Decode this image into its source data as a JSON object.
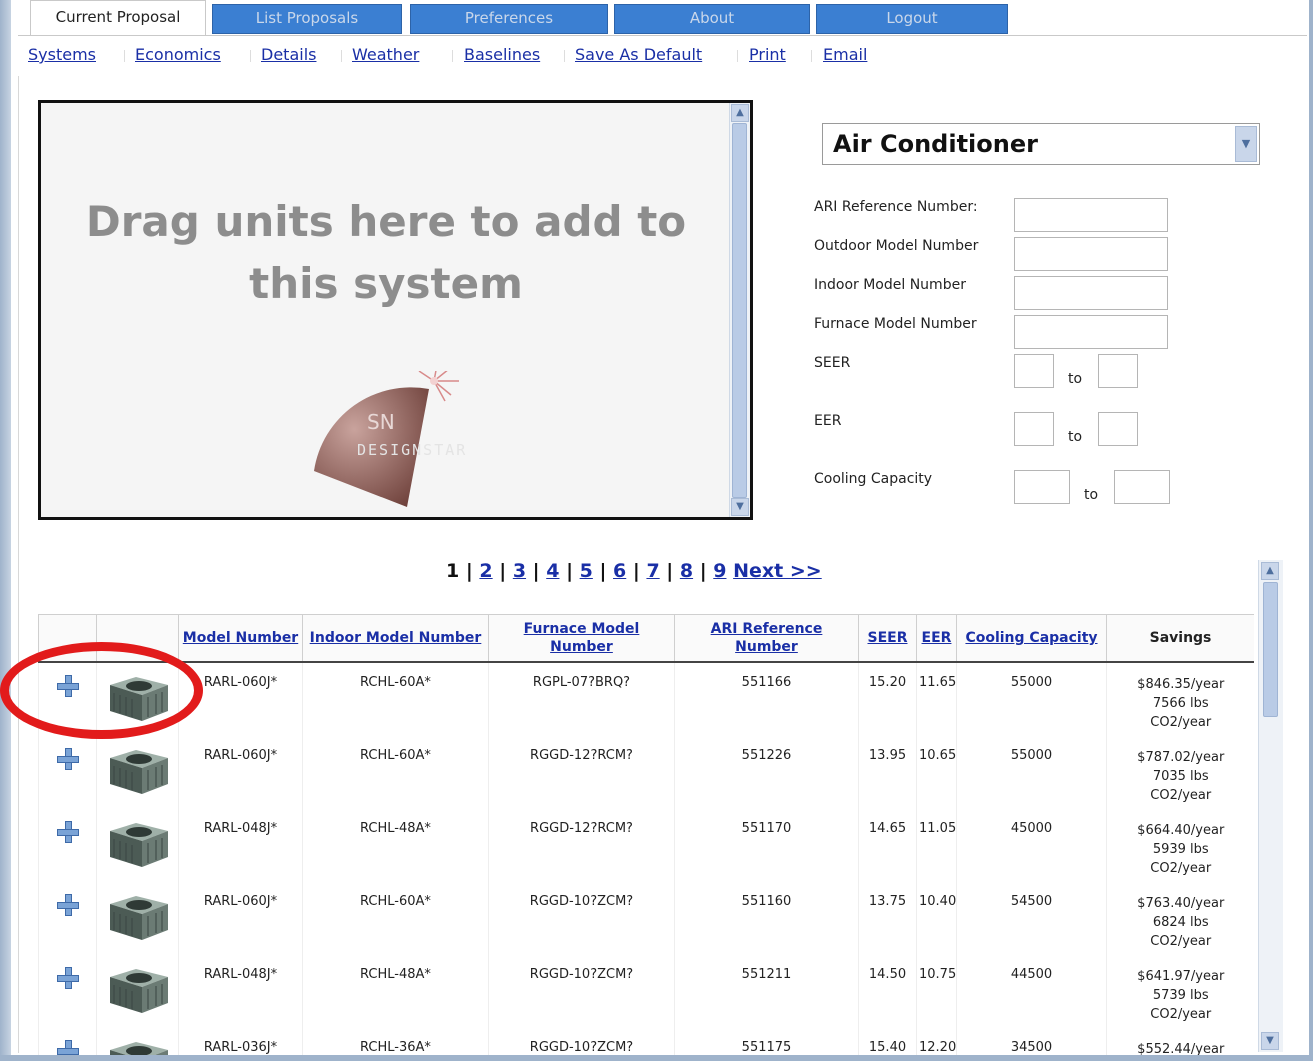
{
  "tabs": [
    {
      "label": "Current Proposal",
      "active": true
    },
    {
      "label": "List Proposals"
    },
    {
      "label": "Preferences"
    },
    {
      "label": "About"
    },
    {
      "label": "Logout"
    }
  ],
  "subnav": [
    "Systems",
    "Economics",
    "Details",
    "Weather",
    "Baselines",
    "Save As Default",
    "Print",
    "Email"
  ],
  "dropzone": {
    "text": "Drag units here to add to this system",
    "logo_text": "DESIGNSTAR"
  },
  "filter": {
    "equipment_type": "Air Conditioner",
    "ari_label": "ARI Reference Number:",
    "outdoor_label": "Outdoor Model Number",
    "indoor_label": "Indoor Model Number",
    "furnace_label": "Furnace Model Number",
    "seer_label": "SEER",
    "eer_label": "EER",
    "cooling_label": "Cooling Capacity",
    "to_label": "to"
  },
  "pager": {
    "current": "1",
    "pages": [
      "2",
      "3",
      "4",
      "5",
      "6",
      "7",
      "8",
      "9"
    ],
    "next": "Next >>"
  },
  "table": {
    "headers": {
      "model": "Model Number",
      "indoor": "Indoor Model Number",
      "furnace": "Furnace Model Number",
      "ari": "ARI Reference Number",
      "seer": "SEER",
      "eer": "EER",
      "cooling": "Cooling Capacity",
      "savings": "Savings"
    },
    "rows": [
      {
        "model": "RARL-060J*",
        "indoor": "RCHL-60A*",
        "furnace": "RGPL-07?BRQ?",
        "ari": "551166",
        "seer": "15.20",
        "eer": "11.65",
        "cooling": "55000",
        "savings": [
          "$846.35/year",
          "7566 lbs",
          "CO2/year"
        ]
      },
      {
        "model": "RARL-060J*",
        "indoor": "RCHL-60A*",
        "furnace": "RGGD-12?RCM?",
        "ari": "551226",
        "seer": "13.95",
        "eer": "10.65",
        "cooling": "55000",
        "savings": [
          "$787.02/year",
          "7035 lbs",
          "CO2/year"
        ]
      },
      {
        "model": "RARL-048J*",
        "indoor": "RCHL-48A*",
        "furnace": "RGGD-12?RCM?",
        "ari": "551170",
        "seer": "14.65",
        "eer": "11.05",
        "cooling": "45000",
        "savings": [
          "$664.40/year",
          "5939 lbs",
          "CO2/year"
        ]
      },
      {
        "model": "RARL-060J*",
        "indoor": "RCHL-60A*",
        "furnace": "RGGD-10?ZCM?",
        "ari": "551160",
        "seer": "13.75",
        "eer": "10.40",
        "cooling": "54500",
        "savings": [
          "$763.40/year",
          "6824 lbs",
          "CO2/year"
        ]
      },
      {
        "model": "RARL-048J*",
        "indoor": "RCHL-48A*",
        "furnace": "RGGD-10?ZCM?",
        "ari": "551211",
        "seer": "14.50",
        "eer": "10.75",
        "cooling": "44500",
        "savings": [
          "$641.97/year",
          "5739 lbs",
          "CO2/year"
        ]
      },
      {
        "model": "RARL-036J*",
        "indoor": "RCHL-36A*",
        "furnace": "RGGD-10?ZCM?",
        "ari": "551175",
        "seer": "15.40",
        "eer": "12.20",
        "cooling": "34500",
        "savings": [
          "$552.44/year",
          "",
          ""
        ]
      }
    ]
  }
}
